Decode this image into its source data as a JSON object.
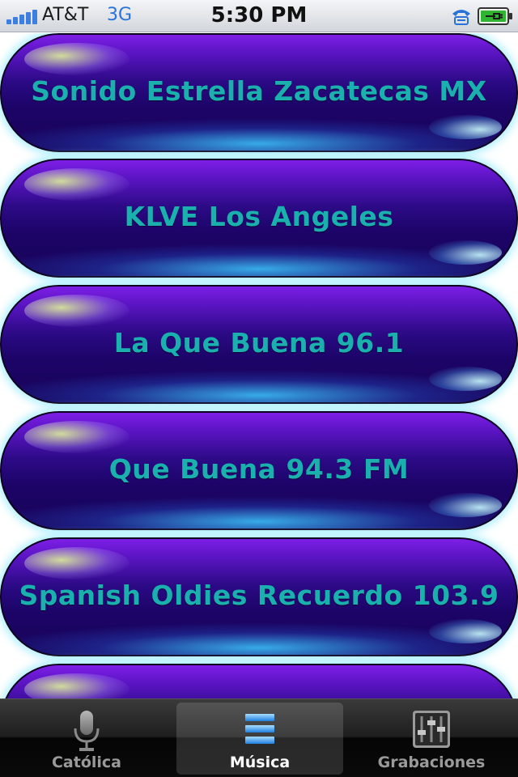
{
  "status_bar": {
    "carrier": "AT&T",
    "network": "3G",
    "time": "5:30 PM"
  },
  "stations": [
    {
      "name": "Sonido Estrella Zacatecas MX"
    },
    {
      "name": "KLVE Los Angeles"
    },
    {
      "name": "La Que Buena 96.1"
    },
    {
      "name": "Que Buena 94.3 FM"
    },
    {
      "name": "Spanish Oldies Recuerdo 103.9"
    },
    {
      "name": ""
    }
  ],
  "tab_bar": {
    "tabs": [
      {
        "label": "Católica",
        "icon": "microphone-icon",
        "selected": false
      },
      {
        "label": "Música",
        "icon": "list-icon",
        "selected": true
      },
      {
        "label": "Grabaciones",
        "icon": "equalizer-icon",
        "selected": false
      }
    ]
  },
  "colors": {
    "button_text": "#1ab0ae",
    "button_dark": "#1c0468",
    "button_light": "#7d1fe6",
    "glow": "#96ebff",
    "selected_tab_label": "#ffffff",
    "tab_label": "#9a9a9a"
  }
}
